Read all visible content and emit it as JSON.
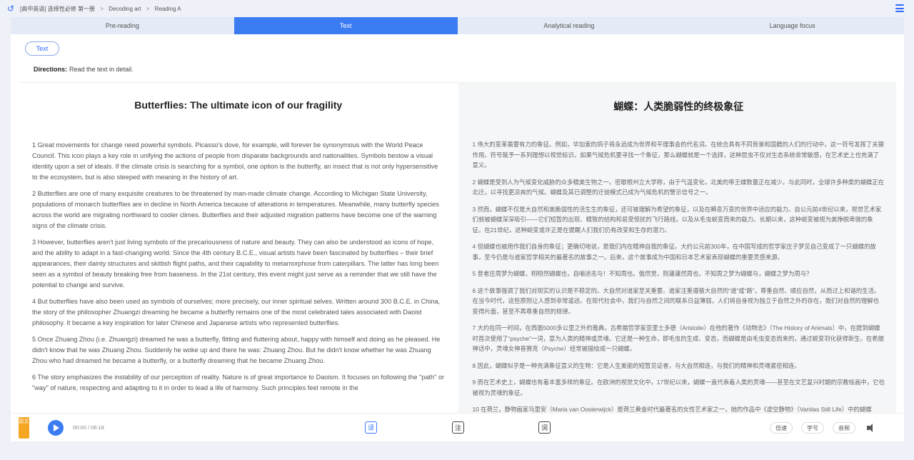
{
  "breadcrumb": {
    "items": [
      "[高中英语] 选择性必修 第一册",
      "Decoding art",
      "Reading A"
    ]
  },
  "tabs": [
    {
      "label": "Pre-reading",
      "active": false
    },
    {
      "label": "Text",
      "active": true
    },
    {
      "label": "Analytical reading",
      "active": false
    },
    {
      "label": "Language focus",
      "active": false
    }
  ],
  "section_pill": "Text",
  "directions": {
    "label": "Directions:",
    "text": "Read the text in detail."
  },
  "article_en": {
    "title": "Butterflies: The ultimate icon of our fragility",
    "paragraphs": [
      "1 Great movements for change need powerful symbols. Picasso's dove, for example, will forever be synonymous with the World Peace Council. This icon plays a key role in unifying the actions of people from disparate backgrounds and nationalities. Symbols bestow a visual identity upon a set of ideals. If the climate crisis is searching for a symbol, one option is the butterfly, an insect that is not only hypersensitive to the ecosystem, but is also steeped with meaning in the history of art.",
      "2 Butterflies are one of many exquisite creatures to be threatened by man-made climate change. According to Michigan State University, populations of monarch butterflies are in decline in North America because of alterations in temperatures. Meanwhile, many butterfly species across the world are migrating northward to cooler climes. Butterflies and their adjusted migration patterns have become one of the warning signs of the climate crisis.",
      "3 However, butterflies aren't just living symbols of the precariousness of nature and beauty. They can also be understood as icons of hope, and the ability to adapt in a fast-changing world. Since the 4th century B.C.E., visual artists have been fascinated by butterflies – their brief appearances, their dainty structures and skittish flight paths, and their capability to metamorphose from caterpillars. The latter has long been seen as a symbol of beauty breaking free from baseness. In the 21st century, this event might just serve as a reminder that we still have the potential to change and survive.",
      "4 But butterflies have also been used as symbols of ourselves; more precisely, our inner spiritual selves. Written around 300 B.C.E. in China, the story of the philosopher Zhuangzi dreaming he became a butterfly remains one of the most celebrated tales associated with Daoist philosophy. It became a key inspiration for later Chinese and Japanese artists who represented butterflies.",
      "5 Once Zhuang Zhou (i.e. Zhuangzi) dreamed he was a butterfly, flitting and fluttering about, happy with himself and doing as he pleased. He didn't know that he was Zhuang Zhou. Suddenly he woke up and there he was: Zhuang Zhou. But he didn't know whether he was Zhuang Zhou who had dreamed he became a butterfly, or a butterfly dreaming that he became Zhuang Zhou.",
      "6 The story emphasizes the instability of our perception of reality. Nature is of great importance to Daoism. It focuses on following the \"path\" or \"way\" of nature, respecting and adapting to it in order to lead a life of harmony. Such principles feel remote in the"
    ]
  },
  "article_zh": {
    "title": "蝴蝶：人类脆弱性的终极象征",
    "paragraphs": [
      "1 伟大的变革需要有力的象征。例如，毕加索的鸽子将永远成为世界和平理事会的代名词。在统合具有不同背景和国籍的人们的行动中，这一符号发挥了关键作用。符号赋予一系列理想以视觉标识。如果气候危机要寻找一个象征，那么蝴蝶就是一个选择，这种昆虫不仅对生态系统非常敏感，在艺术史上也充满了意义。",
      "2 蝴蝶是受到人为气候变化威胁的众多精美生物之一。密歇根州立大学称，由于气温变化，北美的帝王蝶数量正在减少。与此同时，全球许多种类的蝴蝶正在北迁，以寻找更凉爽的气候。蝴蝶及其已调整的迁徙模式已成为气候危机的警示信号之一。",
      "3 然而，蝴蝶不仅是大自然和美脆弱性的活生生的象征，还可被理解为希望的象征，以及在瞬息万变的世界中适应的能力。自公元前4世纪以来，视觉艺术家们就被蝴蝶深深吸引——它们短暂的出现、精致的结构和易受惊扰的飞行路线，以及从毛虫蜕变而来的能力。长期以来，这种蜕变被视为美挣脱卑微的象征。在21世纪，这种蜕变或许正是在提醒人们我们仍有改变和生存的潜力。",
      "4 但蝴蝶也被用作我们自身的象征；更确切地说，是我们内在精神自我的象征。大约公元前300年，在中国写成的哲学家庄子梦见自己变成了一只蝴蝶的故事，至今仍是与道家哲学相关的最著名的故事之一。后来，这个故事成为中国和日本艺术家表现蝴蝶的重要灵感来源。",
      "5 昔者庄周梦为蝴蝶，栩栩然蝴蝶也，自喻适志与！不知周也。俄然觉，则蘧蘧然周也。不知周之梦为蝴蝶与，蝴蝶之梦为周与？",
      "6 这个故事强调了我们对现实的认识是不稳定的。大自然对道家至关重要。道家注重遵循大自然的“道”或“路”，尊重自然、顺应自然，从而过上和谐的生活。在当今时代，这些原则让人感到非常遥远。在现代社会中，我们与自然之间的联系日益薄弱，人们将自身视为独立于自然之外的存在，我们对自然的理解也变得片面，甚至不再尊重自然的规律。",
      "7 大约在同一时间，在西面5000多公里之外的雅典，古希腊哲学家亚里士多德（Aristotle）在他的著作《动物志》（The History of Animals）中，在提到蝴蝶时首次使用了“psyche”一词，意为人类的精神或灵魂。它还是一种生命，即毛虫的生成、变态，而蝴蝶是由毛虫变态而来的，通过蜕变羽化获得新生。在希腊神话中，灵魂女神普赛克（Psyche）经常被描绘成一只蝴蝶。",
      "8 因此，蝴蝶似乎是一种充满象征意义的生物：它是人生美丽的短暂见证者，与大自然相连，与我们的精神和灵魂紧密相连。",
      "9 而在艺术史上，蝴蝶也有着丰富多样的象征。在欧洲的视觉文化中，17世纪以来，蝴蝶一直代表着人类的灵魂——甚至在文艺复兴时期的宗教绘画中，它也被视为灵魂的象征。",
      "10 在荷兰，静物画家马里安（Maria van Oosterwijck）是荷兰黄金时代最著名的女性艺术家之一，她的作品中《虚空静物》（Vanitas Still Life）中的蝴蝶"
    ]
  },
  "player": {
    "speed_label": "原文",
    "time": "00:00 / 06:18",
    "controls": [
      "译",
      "注",
      "词"
    ],
    "right_buttons": [
      "倍速",
      "字号",
      "音频"
    ]
  }
}
